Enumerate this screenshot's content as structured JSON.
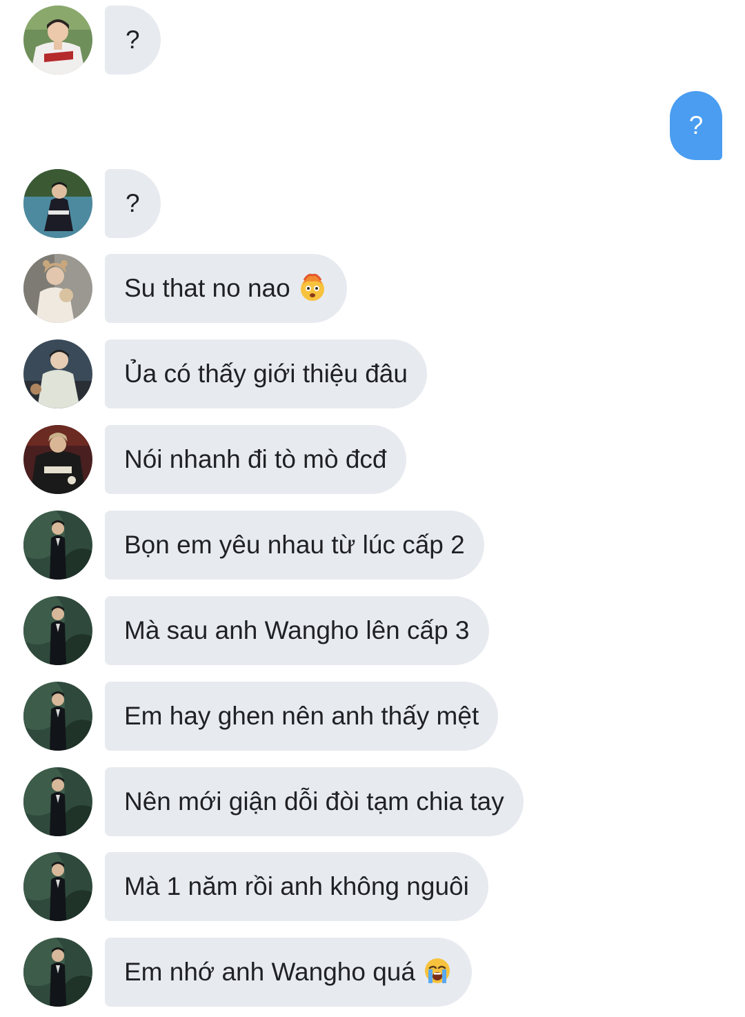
{
  "conversation": {
    "sent": {
      "text": "?"
    },
    "received": [
      {
        "text": "?"
      },
      {
        "text": "?"
      },
      {
        "text": "Su that no nao",
        "emoji": "exploding-head-emoji"
      },
      {
        "text": "Ủa có thấy giới thiệu đâu"
      },
      {
        "text": "Nói nhanh đi tò mò đcđ"
      },
      {
        "text": "Bọn em yêu nhau từ lúc cấp 2"
      },
      {
        "text": "Mà sau anh Wangho lên cấp 3"
      },
      {
        "text": "Em hay ghen nên anh thấy mệt"
      },
      {
        "text": "Nên mới giận dỗi đòi tạm chia tay"
      },
      {
        "text": "Mà 1 năm rồi anh không nguôi"
      },
      {
        "text": "Em nhớ anh Wangho quá",
        "emoji": "loudly-crying-emoji"
      }
    ]
  },
  "colors": {
    "received_bubble": "#e7eaef",
    "sent_bubble": "#4a9df0",
    "text": "#202124"
  }
}
